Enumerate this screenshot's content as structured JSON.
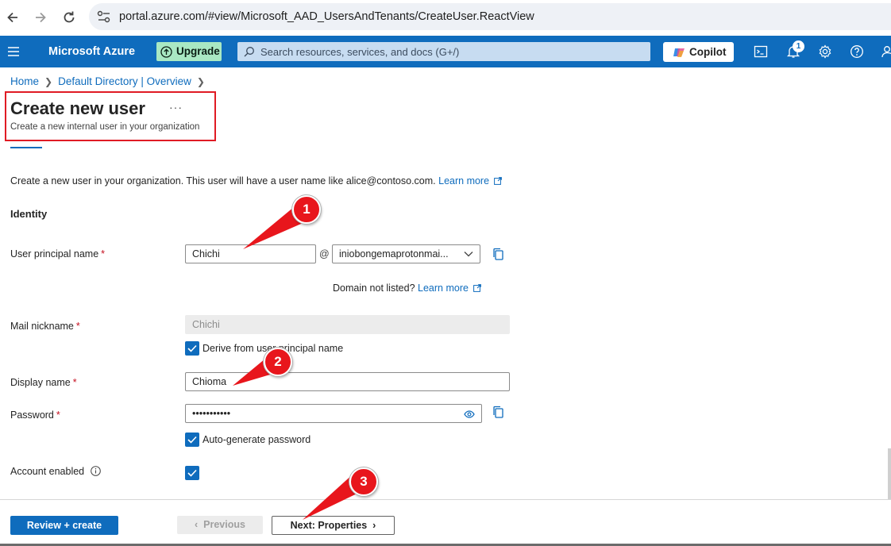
{
  "browser": {
    "url": "portal.azure.com/#view/Microsoft_AAD_UsersAndTenants/CreateUser.ReactView"
  },
  "topbar": {
    "brand": "Microsoft Azure",
    "upgrade_label": "Upgrade",
    "search_placeholder": "Search resources, services, and docs (G+/)",
    "copilot_label": "Copilot",
    "notification_count": "1"
  },
  "breadcrumb": {
    "items": [
      "Home",
      "Default Directory | Overview"
    ]
  },
  "header": {
    "title": "Create new user",
    "more": "···",
    "subtitle": "Create a new internal user in your organization"
  },
  "intro": {
    "text": "Create a new user in your organization. This user will have a user name like alice@contoso.com.",
    "learn_more": "Learn more"
  },
  "identity": {
    "section_title": "Identity",
    "upn_label": "User principal name",
    "upn_value": "Chichi",
    "at_sign": "@",
    "domain_value": "iniobongemaprotonmai...",
    "domain_note": "Domain not listed?",
    "domain_learn_more": "Learn more",
    "mail_nickname_label": "Mail nickname",
    "mail_nickname_value": "Chichi",
    "derive_label": "Derive from user principal name",
    "display_name_label": "Display name",
    "display_name_value": "Chioma",
    "password_label": "Password",
    "password_value": "•••••••••••",
    "autogen_label": "Auto-generate password",
    "account_enabled_label": "Account enabled",
    "required_mark": "*"
  },
  "footer": {
    "review_create": "Review + create",
    "previous": "Previous",
    "next": "Next: Properties"
  },
  "annotations": {
    "markers": [
      "1",
      "2",
      "3"
    ],
    "color": "#e8161c"
  },
  "colors": {
    "azure_blue": "#0f6cbd",
    "upgrade_green": "#a9e8c3",
    "highlight_red": "#e01b24"
  }
}
